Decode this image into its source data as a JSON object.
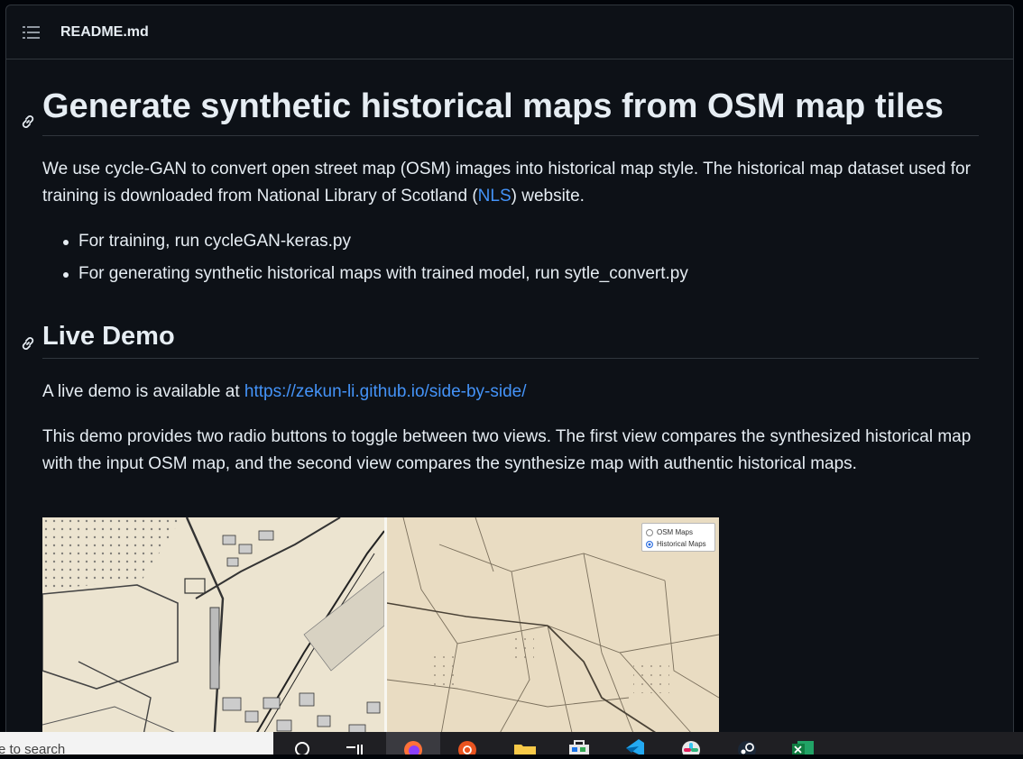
{
  "readme": {
    "filename": "README.md"
  },
  "article": {
    "h1": "Generate synthetic historical maps from OSM map tiles",
    "intro_before": "We use cycle-GAN to convert open street map (OSM) images into historical map style. The historical map dataset used for training is downloaded from National Library of Scotland (",
    "intro_link": "NLS",
    "intro_after": ") website.",
    "bullets": [
      "For training, run cycleGAN-keras.py",
      "For generating synthetic historical maps with trained model, run sytle_convert.py"
    ],
    "h2": "Live Demo",
    "demo_before": "A live demo is available at ",
    "demo_link": "https://zekun-li.github.io/side-by-side/",
    "demo_description": "This demo provides two radio buttons to toggle between two views. The first view compares the synthesized historical map with the input OSM map, and the second view compares the synthesize map with authentic historical maps."
  },
  "demo_image": {
    "radio_options": [
      {
        "label": "OSM Maps",
        "checked": false
      },
      {
        "label": "Historical Maps",
        "checked": true
      }
    ]
  },
  "taskbar": {
    "search_placeholder": "e to search",
    "icons": [
      "search-icon",
      "task-view-icon",
      "firefox-icon",
      "ubuntu-icon",
      "file-explorer-icon",
      "store-icon",
      "vscode-icon",
      "slack-icon",
      "steam-icon",
      "excel-icon"
    ]
  },
  "colors": {
    "background": "#0d1117",
    "border": "#30363d",
    "text": "#e6edf3",
    "link": "#4493f8"
  }
}
